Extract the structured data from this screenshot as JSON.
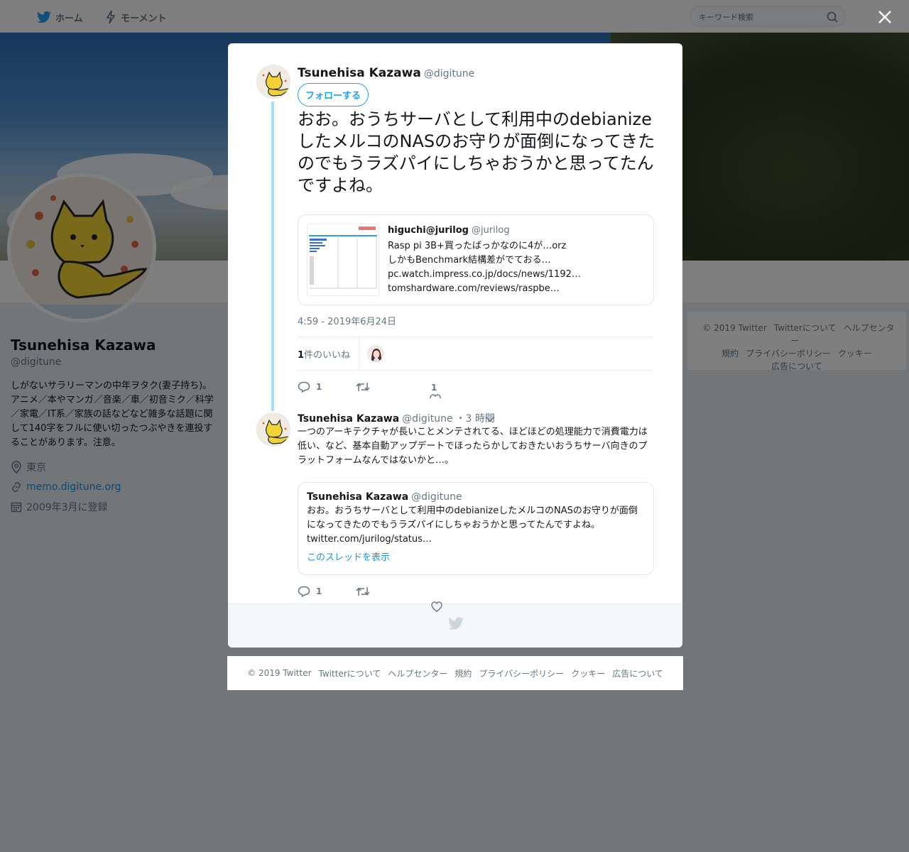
{
  "nav": {
    "home_label": "ホーム",
    "moments_label": "モーメント",
    "search_placeholder": "キーワード検索"
  },
  "profile": {
    "name": "Tsunehisa Kazawa",
    "handle": "@digitune",
    "bio": "しがないサラリーマンの中年ヲタク(妻子持ち)。アニメ／本やマンガ／音楽／車／初音ミク／科学／家電／IT系／家族の話などなど雑多な話題に関して140字をフルに使い切ったつぶやきを連投することがあります。注意。",
    "location": "東京",
    "website": "memo.digitune.org",
    "joined": "2009年3月に登録"
  },
  "side_footer": {
    "items": [
      "© 2019 Twitter",
      "Twitterについて",
      "ヘルプセンター",
      "規約",
      "プライバシーポリシー",
      "クッキー",
      "広告について"
    ]
  },
  "modal": {
    "tweet": {
      "author_name": "Tsunehisa Kazawa",
      "author_handle": "@digitune",
      "follow_label": "フォローする",
      "text": "おお。おうちサーバとして利用中のdebianizeしたメルコのNASのお守りが面倒になってきたのでもうラズパイにしちゃおうかと思ってたんですよね。",
      "quote": {
        "author_name": "higuchi@jurilog",
        "author_handle": "@jurilog",
        "lines": [
          "Rasp pi 3B+買ったばっかなのに4が…orz",
          "しかもBenchmark結構差がでておる…",
          "pc.watch.impress.co.jp/docs/news/1192…",
          "tomshardware.com/reviews/raspbe…"
        ]
      },
      "timestamp": "4:59 - 2019年6月24日",
      "likes_count": "1",
      "likes_label": "件のいいね",
      "reply_count": "1",
      "like_count_action": "1"
    },
    "reply": {
      "author_name": "Tsunehisa Kazawa",
      "author_handle": "@digitune",
      "time": "・3 時間",
      "text": "一つのアーキテクチャが長いことメンテされてる、ほどほどの処理能力で消費電力は低い、など、基本自動アップデートでほったらかしておきたいおうちサーバ向きのプラットフォームなんではないかと…。",
      "quote": {
        "author_name": "Tsunehisa Kazawa",
        "author_handle": "@digitune",
        "text": "おお。おうちサーバとして利用中のdebianizeしたメルコのNASのお守りが面倒になってきたのでもうラズパイにしちゃおうかと思ってたんですよね。",
        "link": "twitter.com/jurilog/status…",
        "show_thread": "このスレッドを表示"
      },
      "reply_count": "1"
    }
  },
  "bottom_footer": {
    "items": [
      "© 2019 Twitter",
      "Twitterについて",
      "ヘルプセンター",
      "規約",
      "プライバシーポリシー",
      "クッキー",
      "広告について"
    ]
  },
  "colors": {
    "brand_blue": "#1da1f2",
    "link_blue": "#1b95e0",
    "thread_line": "#a9daf8",
    "muted_text": "#657786"
  },
  "icons": [
    "twitter-bird-icon",
    "lightning-icon",
    "search-icon",
    "close-icon",
    "location-pin-icon",
    "link-icon",
    "calendar-icon",
    "reply-icon",
    "retweet-icon",
    "heart-icon",
    "chevron-down-icon"
  ]
}
